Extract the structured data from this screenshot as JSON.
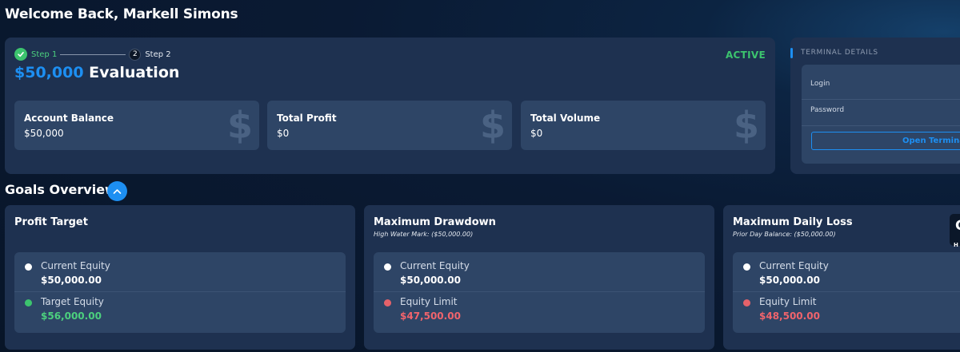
{
  "header": {
    "welcome": "Welcome Back, Markell Simons"
  },
  "evaluation": {
    "step1_label": "Step 1",
    "step2_number": "2",
    "step2_label": "Step 2",
    "amount": "$50,000",
    "title_suffix": "Evaluation",
    "status": "ACTIVE",
    "stats": [
      {
        "title": "Account Balance",
        "value": "$50,000",
        "icon": "$"
      },
      {
        "title": "Total Profit",
        "value": "$0",
        "icon": "$"
      },
      {
        "title": "Total Volume",
        "value": "$0",
        "icon": "$"
      }
    ]
  },
  "terminal": {
    "title": "TERMINAL DETAILS",
    "login_label": "Login",
    "password_label": "Password",
    "open_button": "Open Terminal"
  },
  "goals": {
    "title": "Goals Overview",
    "cards": [
      {
        "title": "Profit Target",
        "subtitle": "",
        "rows": [
          {
            "label": "Current Equity",
            "value": "$50,000.00",
            "dot_color": "#ffffff",
            "value_color": "#ffffff"
          },
          {
            "label": "Target Equity",
            "value": "$56,000.00",
            "dot_color": "#3cc46e",
            "value_color": "#4cd07e"
          }
        ]
      },
      {
        "title": "Maximum Drawdown",
        "subtitle": "High Water Mark: ($50,000.00)",
        "rows": [
          {
            "label": "Current Equity",
            "value": "$50,000.00",
            "dot_color": "#ffffff",
            "value_color": "#ffffff"
          },
          {
            "label": "Equity Limit",
            "value": "$47,500.00",
            "dot_color": "#e5626a",
            "value_color": "#f0646c"
          }
        ]
      },
      {
        "title": "Maximum Daily Loss",
        "subtitle": "Prior Day Balance: ($50,000.00)",
        "rows": [
          {
            "label": "Current Equity",
            "value": "$50,000.00",
            "dot_color": "#ffffff",
            "value_color": "#ffffff"
          },
          {
            "label": "Equity Limit",
            "value": "$48,500.00",
            "dot_color": "#e5626a",
            "value_color": "#f0646c"
          }
        ]
      }
    ],
    "side_widget": {
      "glyph": "C",
      "label": "H"
    }
  },
  "colors": {
    "accent": "#1d8ff2",
    "success": "#3cc46e",
    "danger": "#f0646c",
    "card": "#1e3150",
    "inner": "#2e4566"
  }
}
